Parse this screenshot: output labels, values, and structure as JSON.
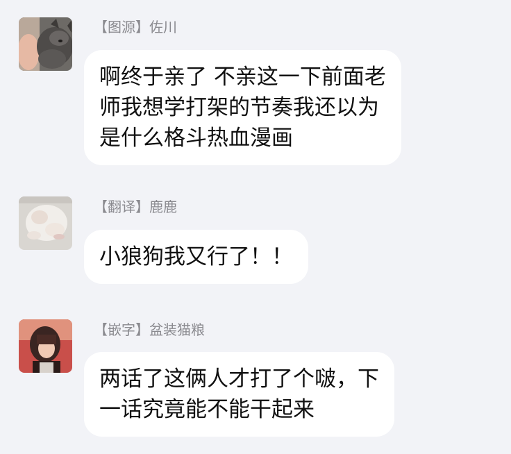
{
  "messages": [
    {
      "name": "【图源】佐川",
      "avatar_icon": "cat-photo-avatar",
      "lines": [
        "啊终于亲了 不亲这一下前面老",
        "师我想学打架的节奏我还以为",
        "是什么格斗热血漫画"
      ]
    },
    {
      "name": "【翻译】鹿鹿",
      "avatar_icon": "kitten-photo-avatar",
      "lines": [
        "小狼狗我又行了！！"
      ]
    },
    {
      "name": "【嵌字】盆装猫粮",
      "avatar_icon": "anime-character-avatar",
      "lines": [
        "两话了这俩人才打了个啵，下",
        "一话究竟能不能干起来"
      ]
    }
  ],
  "colors": {
    "background": "#f2f3f7",
    "bubble": "#ffffff",
    "name_text": "#8a8a8f",
    "message_text": "#111111"
  }
}
